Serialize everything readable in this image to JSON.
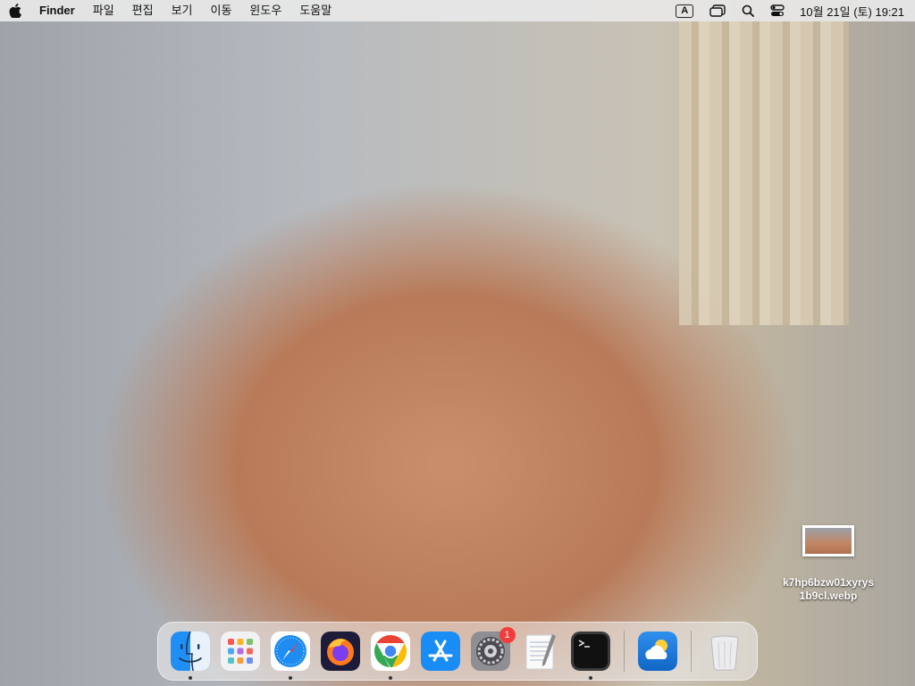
{
  "menubar": {
    "app_name": "Finder",
    "menus": [
      "파일",
      "편집",
      "보기",
      "이동",
      "윈도우",
      "도움말"
    ],
    "input_source": "A",
    "clock": "10월 21일 (토) 19:21"
  },
  "desktop": {
    "file": {
      "name_line1": "k7hp6bzw01xyrys",
      "name_line2": "1b9cl.webp"
    }
  },
  "dock": {
    "items": [
      {
        "icon": "finder-icon",
        "running": true
      },
      {
        "icon": "launchpad-icon",
        "running": false
      },
      {
        "icon": "safari-icon",
        "running": true
      },
      {
        "icon": "firefox-icon",
        "running": false
      },
      {
        "icon": "chrome-icon",
        "running": true
      },
      {
        "icon": "app-store-icon",
        "running": false
      },
      {
        "icon": "system-settings-icon",
        "running": false,
        "badge": "1"
      },
      {
        "icon": "textedit-icon",
        "running": false
      },
      {
        "icon": "terminal-icon",
        "running": true
      },
      {
        "icon": "weather-icon",
        "running": false
      },
      {
        "icon": "trash-icon",
        "running": false
      }
    ]
  },
  "colors": {
    "menubar_bg": "#e8e8e8",
    "badge": "#f23d3d",
    "safari_blue": "#1e8cf0",
    "appstore_blue": "#1a8cf5"
  }
}
